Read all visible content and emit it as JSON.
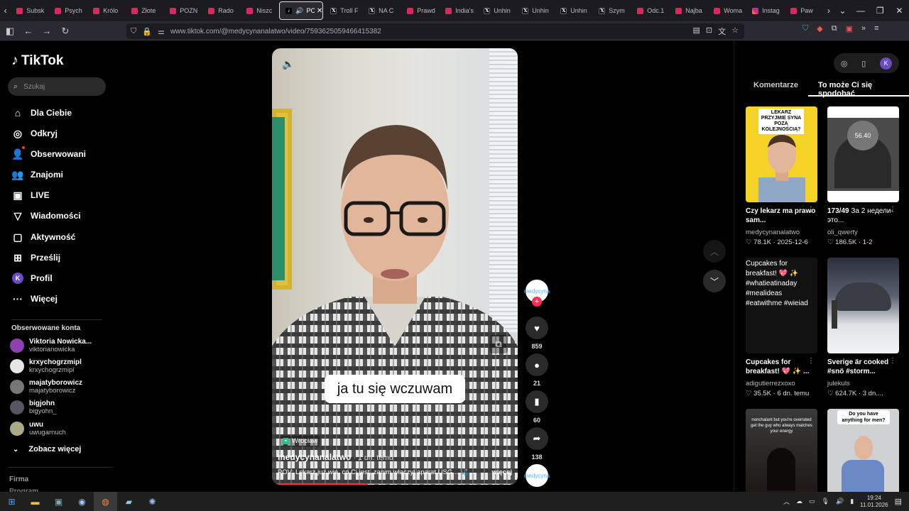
{
  "browser": {
    "tabs": [
      {
        "title": "Subsk",
        "fav": "yt"
      },
      {
        "title": "Psych",
        "fav": "yt"
      },
      {
        "title": "Królo",
        "fav": "yt"
      },
      {
        "title": "Złote",
        "fav": "yt"
      },
      {
        "title": "POZN",
        "fav": "yt"
      },
      {
        "title": "Rado",
        "fav": "yt"
      },
      {
        "title": "Niszc",
        "fav": "yt"
      },
      {
        "title": "PO",
        "fav": "tt",
        "active": true
      },
      {
        "title": "Troll F",
        "fav": "x"
      },
      {
        "title": "NA C",
        "fav": "x"
      },
      {
        "title": "Prawd",
        "fav": "yt"
      },
      {
        "title": "India's",
        "fav": "yt"
      },
      {
        "title": "Unhin",
        "fav": "x"
      },
      {
        "title": "Unhin",
        "fav": "x"
      },
      {
        "title": "Unhin",
        "fav": "x"
      },
      {
        "title": "Szym",
        "fav": "x"
      },
      {
        "title": "Odc.1",
        "fav": "yt"
      },
      {
        "title": "Najba",
        "fav": "yt"
      },
      {
        "title": "Woma",
        "fav": "yt"
      },
      {
        "title": "Instag",
        "fav": "ig"
      },
      {
        "title": "Paw",
        "fav": "yt"
      }
    ],
    "url_host": "www.tiktok.com",
    "url_path": "/@medycynanalatwo/video/7593625059466415382"
  },
  "sidebar": {
    "logo": "TikTok",
    "search_placeholder": "Szukaj",
    "nav": [
      {
        "label": "Dla Ciebie",
        "icon": "home-icon",
        "glyph": "⌂"
      },
      {
        "label": "Odkryj",
        "icon": "compass-icon",
        "glyph": "◎"
      },
      {
        "label": "Obserwowani",
        "icon": "following-icon",
        "glyph": "👤"
      },
      {
        "label": "Znajomi",
        "icon": "friends-icon",
        "glyph": "👥"
      },
      {
        "label": "LIVE",
        "icon": "live-icon",
        "glyph": "▣"
      },
      {
        "label": "Wiadomości",
        "icon": "messages-icon",
        "glyph": "▽"
      },
      {
        "label": "Aktywność",
        "icon": "activity-icon",
        "glyph": "▢"
      },
      {
        "label": "Prześlij",
        "icon": "upload-icon",
        "glyph": "⊞"
      },
      {
        "label": "Profil",
        "icon": "profile-icon",
        "glyph": "K"
      },
      {
        "label": "Więcej",
        "icon": "more-icon",
        "glyph": "···"
      }
    ],
    "following_title": "Obserwowane konta",
    "accounts": [
      {
        "name": "Viktoria Nowicka...",
        "handle": "viktorianowicka",
        "color": "#8e3fb0"
      },
      {
        "name": "krxychogrzmipl",
        "handle": "krxychogrzmipl",
        "color": "#e6e6e6"
      },
      {
        "name": "majatyborowicz",
        "handle": "majatyborowicz",
        "color": "#777"
      },
      {
        "name": "bigjohn",
        "handle": "bigyohn_",
        "color": "#556"
      },
      {
        "name": "uwu",
        "handle": "uwugarnuch",
        "color": "#aa8"
      }
    ],
    "see_more": "Zobacz więcej",
    "footer_1": "Firma",
    "footer_2": "Program"
  },
  "video": {
    "caption": "ja tu się wczuwam",
    "location": "Wrocław",
    "author": "medycynanalatwo",
    "time": "· 1 dn. temu",
    "description": "POV: Lekarz już wie, co Ci jest, zanim włączył aparat USG... 🩺 ...",
    "more_label": "więcej",
    "progress": 0.39
  },
  "actions": {
    "likes": "859",
    "comments": "21",
    "saves": "60",
    "shares": "138",
    "creator_avatar_text": "medycyna"
  },
  "right_panel": {
    "tab_comments": "Komentarze",
    "tab_suggested": "To może Ci się spodobać",
    "avatar_letter": "K",
    "cards": [
      {
        "title": "Czy lekarz ma prawo sam...",
        "author": "medycynanalatwo",
        "likes": "78.1K",
        "date": "2025-12-6",
        "thumb_text": "LEKARZ PRZYJMIE SYNA POZA KOLEJNOŚCIĄ?"
      },
      {
        "title_bold": "173/49",
        "title_rest": " За 2 недели-это...",
        "author": "oli_qwerty",
        "likes": "186.5K",
        "date": "1-2",
        "thumb_text": "56.40"
      },
      {
        "title": "Cupcakes for breakfast! 💖 ✨ ...",
        "author": "adigutierrezxoxo",
        "likes": "35.5K",
        "date": "6 dn. temu",
        "thumb_text": "Cupcakes for breakfast! 💖 ✨ #whatieatinaday #mealideas #eatwithme #wieiad"
      },
      {
        "title": "Sverige är cooked #snö #storm...",
        "author": "julekuls",
        "likes": "624.7K",
        "date": "3 dn....",
        "thumb_text": ""
      },
      {
        "title": "",
        "author": "",
        "likes": "",
        "date": "",
        "thumb_text": "nonchalant but you're overrated get the guy who always matches your energy"
      },
      {
        "title": "",
        "author": "",
        "likes": "",
        "date": "",
        "thumb_text": "Do you have anything for men?"
      }
    ]
  },
  "taskbar": {
    "time": "19:24",
    "date": "11.01.2026"
  }
}
